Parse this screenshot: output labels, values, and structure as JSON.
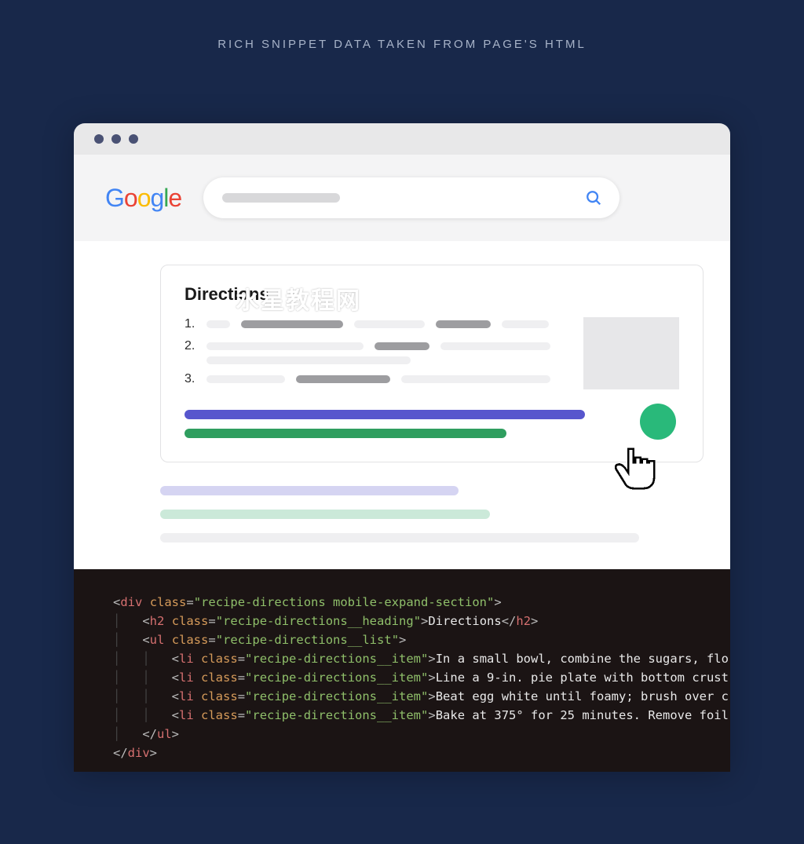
{
  "title": "RICH SNIPPET DATA TAKEN FROM PAGE'S HTML",
  "logo": {
    "letters": [
      "G",
      "o",
      "o",
      "g",
      "l",
      "e"
    ]
  },
  "snippet": {
    "heading": "Directions",
    "items": [
      "1.",
      "2.",
      "3."
    ]
  },
  "watermark": "水星教程网",
  "code": {
    "div_open": {
      "tag": "div",
      "attr": "class",
      "val": "recipe-directions mobile-expand-section"
    },
    "h2": {
      "tag": "h2",
      "attr": "class",
      "val": "recipe-directions__heading",
      "text": "Directions"
    },
    "ul": {
      "tag": "ul",
      "attr": "class",
      "val": "recipe-directions__list"
    },
    "li_attr": "class",
    "li_val": "recipe-directions__item",
    "li_tag": "li",
    "li_texts": [
      "In a small bowl, combine the sugars, flo",
      "Line a 9-in. pie plate with bottom crust",
      "Beat egg white until foamy; brush over c",
      "Bake at 375° for 25 minutes. Remove foil"
    ],
    "ul_close": "ul",
    "div_close": "div"
  }
}
